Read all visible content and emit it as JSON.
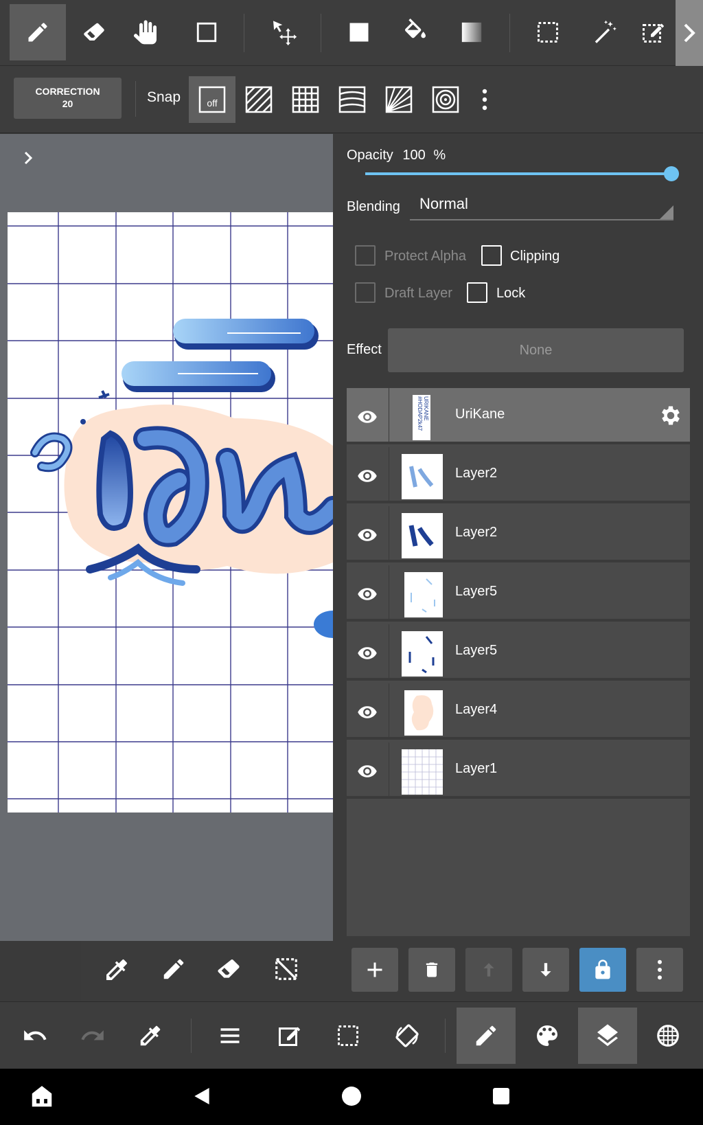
{
  "toolbar": {
    "tools": [
      "pen-tool",
      "eraser-tool",
      "hand-tool",
      "rectangle-tool",
      "move-tool",
      "fill-color-tool",
      "bucket-tool",
      "gradient-tool",
      "select-rect-tool",
      "magic-wand-tool",
      "select-pen-tool"
    ],
    "active_tool": "pen-tool"
  },
  "snapbar": {
    "correction_label": "CORRECTION",
    "correction_value": "20",
    "snap_label": "Snap",
    "snap_off_label": "off"
  },
  "panel": {
    "opacity_label": "Opacity",
    "opacity_value": "100",
    "opacity_unit": "%",
    "opacity_fraction": 1.0,
    "blending_label": "Blending",
    "blending_value": "Normal",
    "protect_alpha_label": "Protect Alpha",
    "clipping_label": "Clipping",
    "draft_layer_label": "Draft Layer",
    "lock_label": "Lock",
    "effect_label": "Effect",
    "effect_value": "None"
  },
  "layers": [
    {
      "name": "UriKane",
      "selected": true
    },
    {
      "name": "Layer2",
      "selected": false
    },
    {
      "name": "Layer2",
      "selected": false
    },
    {
      "name": "Layer5",
      "selected": false
    },
    {
      "name": "Layer5",
      "selected": false
    },
    {
      "name": "Layer4",
      "selected": false
    },
    {
      "name": "Layer1",
      "selected": false
    }
  ],
  "thumb_text": {
    "urikane_line1": "URIKANE",
    "urikane_line2": "#HODAP2k47"
  },
  "colors": {
    "accent_blue": "#4a8ec4",
    "slider_blue": "#6ec3f2",
    "canvas_bg": "#686b70",
    "grid_line": "#3b3a8c",
    "lettering_blue": "#2b5fb5",
    "peach_shadow": "#fde3d2"
  }
}
